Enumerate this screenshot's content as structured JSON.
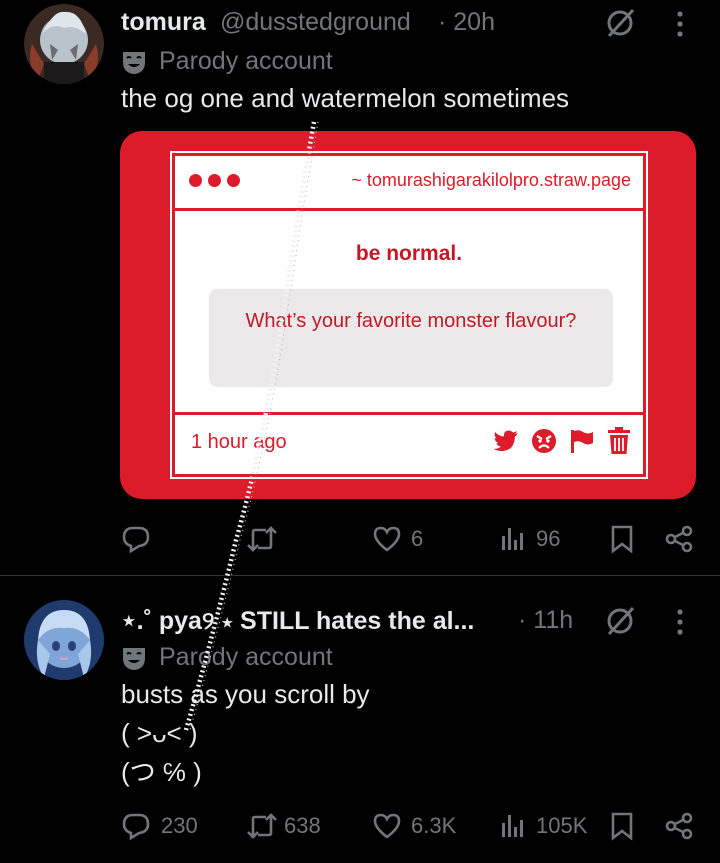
{
  "tweets": [
    {
      "name": "tomura",
      "handle": "@dusstedground",
      "time": "· 20h",
      "parody_label": "Parody account",
      "text": "the og one and watermelon sometimes",
      "card": {
        "url": "~ tomurashigarakilolpro.straw.page",
        "heading": "be normal.",
        "question": "What’s your favorite monster flavour?",
        "time": "1 hour ago",
        "icons": [
          "twitter-icon",
          "angry-face-icon",
          "flag-icon",
          "trash-icon"
        ]
      },
      "actions": {
        "replies": "",
        "reposts": "",
        "likes": "6",
        "views": "96"
      }
    },
    {
      "name": "⋆.˚ pya୨ ⋆ STILL hates the al...",
      "handle": "",
      "time": "· 11h",
      "parody_label": "Parody account",
      "lines": [
        "busts as you scroll by",
        "( ˃ᴗ˂ )",
        "(つ ℅ )"
      ],
      "actions": {
        "replies": "230",
        "reposts": "638",
        "likes": "6.3K",
        "views": "105K"
      }
    }
  ],
  "colors": {
    "accent": "#dc1b2b",
    "muted": "#71767b",
    "text": "#e7e9ea",
    "background": "#000000"
  }
}
